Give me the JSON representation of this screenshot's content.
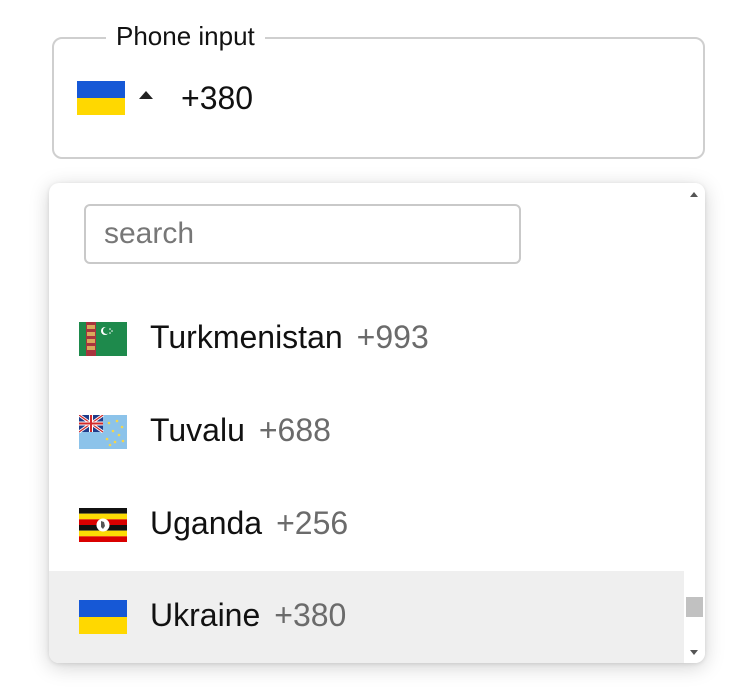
{
  "phone_field": {
    "legend": "Phone input",
    "selected_flag": "ukraine-flag",
    "value": "+380"
  },
  "dropdown": {
    "search_placeholder": "search",
    "options": [
      {
        "country": "Turkmenistan",
        "dial": "+993",
        "flag": "turkmenistan-flag",
        "highlighted": false
      },
      {
        "country": "Tuvalu",
        "dial": "+688",
        "flag": "tuvalu-flag",
        "highlighted": false
      },
      {
        "country": "Uganda",
        "dial": "+256",
        "flag": "uganda-flag",
        "highlighted": false
      },
      {
        "country": "Ukraine",
        "dial": "+380",
        "flag": "ukraine-flag",
        "highlighted": true
      }
    ]
  },
  "colors": {
    "border": "#cfcfcf",
    "highlight": "#efefef",
    "dial_text": "#6b6b6b"
  }
}
